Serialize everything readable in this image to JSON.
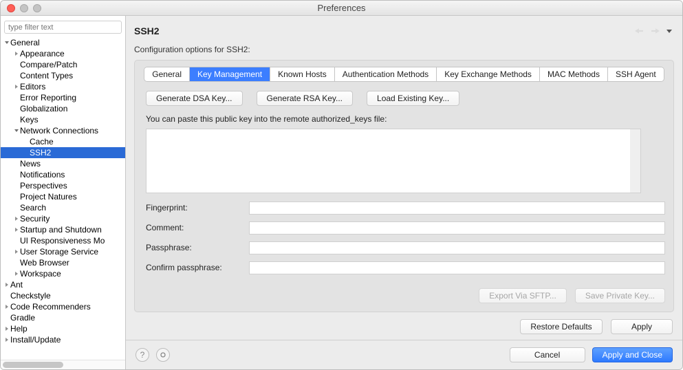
{
  "window": {
    "title": "Preferences"
  },
  "sidebar": {
    "filter_placeholder": "type filter text",
    "items": [
      {
        "label": "General",
        "indent": 0,
        "arrow": "down"
      },
      {
        "label": "Appearance",
        "indent": 1,
        "arrow": "right"
      },
      {
        "label": "Compare/Patch",
        "indent": 1,
        "arrow": ""
      },
      {
        "label": "Content Types",
        "indent": 1,
        "arrow": ""
      },
      {
        "label": "Editors",
        "indent": 1,
        "arrow": "right"
      },
      {
        "label": "Error Reporting",
        "indent": 1,
        "arrow": ""
      },
      {
        "label": "Globalization",
        "indent": 1,
        "arrow": ""
      },
      {
        "label": "Keys",
        "indent": 1,
        "arrow": ""
      },
      {
        "label": "Network Connections",
        "indent": 1,
        "arrow": "down"
      },
      {
        "label": "Cache",
        "indent": 2,
        "arrow": ""
      },
      {
        "label": "SSH2",
        "indent": 2,
        "arrow": "",
        "selected": true
      },
      {
        "label": "News",
        "indent": 1,
        "arrow": ""
      },
      {
        "label": "Notifications",
        "indent": 1,
        "arrow": ""
      },
      {
        "label": "Perspectives",
        "indent": 1,
        "arrow": ""
      },
      {
        "label": "Project Natures",
        "indent": 1,
        "arrow": ""
      },
      {
        "label": "Search",
        "indent": 1,
        "arrow": ""
      },
      {
        "label": "Security",
        "indent": 1,
        "arrow": "right"
      },
      {
        "label": "Startup and Shutdown",
        "indent": 1,
        "arrow": "right"
      },
      {
        "label": "UI Responsiveness Mo",
        "indent": 1,
        "arrow": ""
      },
      {
        "label": "User Storage Service",
        "indent": 1,
        "arrow": "right"
      },
      {
        "label": "Web Browser",
        "indent": 1,
        "arrow": ""
      },
      {
        "label": "Workspace",
        "indent": 1,
        "arrow": "right"
      },
      {
        "label": "Ant",
        "indent": 0,
        "arrow": "right"
      },
      {
        "label": "Checkstyle",
        "indent": 0,
        "arrow": ""
      },
      {
        "label": "Code Recommenders",
        "indent": 0,
        "arrow": "right"
      },
      {
        "label": "Gradle",
        "indent": 0,
        "arrow": ""
      },
      {
        "label": "Help",
        "indent": 0,
        "arrow": "right"
      },
      {
        "label": "Install/Update",
        "indent": 0,
        "arrow": "right"
      }
    ]
  },
  "main": {
    "heading": "SSH2",
    "subtitle": "Configuration options for SSH2:",
    "tabs": [
      {
        "label": "General"
      },
      {
        "label": "Key Management",
        "active": true
      },
      {
        "label": "Known Hosts"
      },
      {
        "label": "Authentication Methods"
      },
      {
        "label": "Key Exchange Methods"
      },
      {
        "label": "MAC Methods"
      },
      {
        "label": "SSH Agent"
      }
    ],
    "buttons": {
      "gen_dsa": "Generate DSA Key...",
      "gen_rsa": "Generate RSA Key...",
      "load": "Load Existing Key..."
    },
    "helper_text": "You can paste this public key into the remote authorized_keys file:",
    "public_key_value": "",
    "form": {
      "fingerprint_label": "Fingerprint:",
      "fingerprint_value": "",
      "comment_label": "Comment:",
      "comment_value": "",
      "passphrase_label": "Passphrase:",
      "passphrase_value": "",
      "confirm_label": "Confirm passphrase:",
      "confirm_value": ""
    },
    "export_btn": "Export Via SFTP...",
    "save_btn": "Save Private Key...",
    "restore_btn": "Restore Defaults",
    "apply_btn": "Apply"
  },
  "footer": {
    "cancel": "Cancel",
    "apply_close": "Apply and Close"
  }
}
